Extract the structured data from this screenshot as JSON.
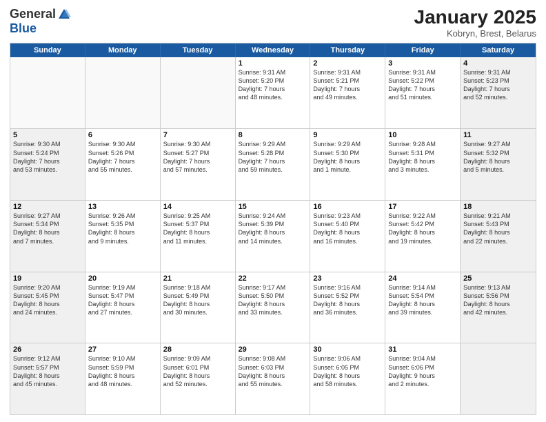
{
  "logo": {
    "general": "General",
    "blue": "Blue"
  },
  "header": {
    "month": "January 2025",
    "location": "Kobryn, Brest, Belarus"
  },
  "weekdays": [
    "Sunday",
    "Monday",
    "Tuesday",
    "Wednesday",
    "Thursday",
    "Friday",
    "Saturday"
  ],
  "rows": [
    [
      {
        "day": "",
        "text": "",
        "empty": true
      },
      {
        "day": "",
        "text": "",
        "empty": true
      },
      {
        "day": "",
        "text": "",
        "empty": true
      },
      {
        "day": "1",
        "text": "Sunrise: 9:31 AM\nSunset: 5:20 PM\nDaylight: 7 hours\nand 48 minutes.",
        "empty": false
      },
      {
        "day": "2",
        "text": "Sunrise: 9:31 AM\nSunset: 5:21 PM\nDaylight: 7 hours\nand 49 minutes.",
        "empty": false
      },
      {
        "day": "3",
        "text": "Sunrise: 9:31 AM\nSunset: 5:22 PM\nDaylight: 7 hours\nand 51 minutes.",
        "empty": false
      },
      {
        "day": "4",
        "text": "Sunrise: 9:31 AM\nSunset: 5:23 PM\nDaylight: 7 hours\nand 52 minutes.",
        "empty": false,
        "shaded": true
      }
    ],
    [
      {
        "day": "5",
        "text": "Sunrise: 9:30 AM\nSunset: 5:24 PM\nDaylight: 7 hours\nand 53 minutes.",
        "empty": false,
        "shaded": true
      },
      {
        "day": "6",
        "text": "Sunrise: 9:30 AM\nSunset: 5:26 PM\nDaylight: 7 hours\nand 55 minutes.",
        "empty": false
      },
      {
        "day": "7",
        "text": "Sunrise: 9:30 AM\nSunset: 5:27 PM\nDaylight: 7 hours\nand 57 minutes.",
        "empty": false
      },
      {
        "day": "8",
        "text": "Sunrise: 9:29 AM\nSunset: 5:28 PM\nDaylight: 7 hours\nand 59 minutes.",
        "empty": false
      },
      {
        "day": "9",
        "text": "Sunrise: 9:29 AM\nSunset: 5:30 PM\nDaylight: 8 hours\nand 1 minute.",
        "empty": false
      },
      {
        "day": "10",
        "text": "Sunrise: 9:28 AM\nSunset: 5:31 PM\nDaylight: 8 hours\nand 3 minutes.",
        "empty": false
      },
      {
        "day": "11",
        "text": "Sunrise: 9:27 AM\nSunset: 5:32 PM\nDaylight: 8 hours\nand 5 minutes.",
        "empty": false,
        "shaded": true
      }
    ],
    [
      {
        "day": "12",
        "text": "Sunrise: 9:27 AM\nSunset: 5:34 PM\nDaylight: 8 hours\nand 7 minutes.",
        "empty": false,
        "shaded": true
      },
      {
        "day": "13",
        "text": "Sunrise: 9:26 AM\nSunset: 5:35 PM\nDaylight: 8 hours\nand 9 minutes.",
        "empty": false
      },
      {
        "day": "14",
        "text": "Sunrise: 9:25 AM\nSunset: 5:37 PM\nDaylight: 8 hours\nand 11 minutes.",
        "empty": false
      },
      {
        "day": "15",
        "text": "Sunrise: 9:24 AM\nSunset: 5:39 PM\nDaylight: 8 hours\nand 14 minutes.",
        "empty": false
      },
      {
        "day": "16",
        "text": "Sunrise: 9:23 AM\nSunset: 5:40 PM\nDaylight: 8 hours\nand 16 minutes.",
        "empty": false
      },
      {
        "day": "17",
        "text": "Sunrise: 9:22 AM\nSunset: 5:42 PM\nDaylight: 8 hours\nand 19 minutes.",
        "empty": false
      },
      {
        "day": "18",
        "text": "Sunrise: 9:21 AM\nSunset: 5:43 PM\nDaylight: 8 hours\nand 22 minutes.",
        "empty": false,
        "shaded": true
      }
    ],
    [
      {
        "day": "19",
        "text": "Sunrise: 9:20 AM\nSunset: 5:45 PM\nDaylight: 8 hours\nand 24 minutes.",
        "empty": false,
        "shaded": true
      },
      {
        "day": "20",
        "text": "Sunrise: 9:19 AM\nSunset: 5:47 PM\nDaylight: 8 hours\nand 27 minutes.",
        "empty": false
      },
      {
        "day": "21",
        "text": "Sunrise: 9:18 AM\nSunset: 5:49 PM\nDaylight: 8 hours\nand 30 minutes.",
        "empty": false
      },
      {
        "day": "22",
        "text": "Sunrise: 9:17 AM\nSunset: 5:50 PM\nDaylight: 8 hours\nand 33 minutes.",
        "empty": false
      },
      {
        "day": "23",
        "text": "Sunrise: 9:16 AM\nSunset: 5:52 PM\nDaylight: 8 hours\nand 36 minutes.",
        "empty": false
      },
      {
        "day": "24",
        "text": "Sunrise: 9:14 AM\nSunset: 5:54 PM\nDaylight: 8 hours\nand 39 minutes.",
        "empty": false
      },
      {
        "day": "25",
        "text": "Sunrise: 9:13 AM\nSunset: 5:56 PM\nDaylight: 8 hours\nand 42 minutes.",
        "empty": false,
        "shaded": true
      }
    ],
    [
      {
        "day": "26",
        "text": "Sunrise: 9:12 AM\nSunset: 5:57 PM\nDaylight: 8 hours\nand 45 minutes.",
        "empty": false,
        "shaded": true
      },
      {
        "day": "27",
        "text": "Sunrise: 9:10 AM\nSunset: 5:59 PM\nDaylight: 8 hours\nand 48 minutes.",
        "empty": false
      },
      {
        "day": "28",
        "text": "Sunrise: 9:09 AM\nSunset: 6:01 PM\nDaylight: 8 hours\nand 52 minutes.",
        "empty": false
      },
      {
        "day": "29",
        "text": "Sunrise: 9:08 AM\nSunset: 6:03 PM\nDaylight: 8 hours\nand 55 minutes.",
        "empty": false
      },
      {
        "day": "30",
        "text": "Sunrise: 9:06 AM\nSunset: 6:05 PM\nDaylight: 8 hours\nand 58 minutes.",
        "empty": false
      },
      {
        "day": "31",
        "text": "Sunrise: 9:04 AM\nSunset: 6:06 PM\nDaylight: 9 hours\nand 2 minutes.",
        "empty": false
      },
      {
        "day": "",
        "text": "",
        "empty": true,
        "shaded": true
      }
    ]
  ]
}
